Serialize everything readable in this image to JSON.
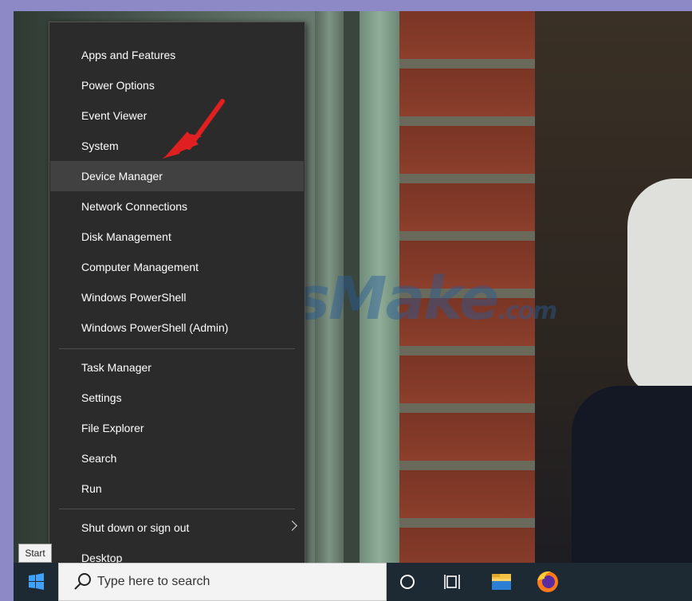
{
  "menu": {
    "items": [
      {
        "label": "Apps and Features"
      },
      {
        "label": "Power Options"
      },
      {
        "label": "Event Viewer"
      },
      {
        "label": "System"
      },
      {
        "label": "Device Manager",
        "highlighted": true
      },
      {
        "label": "Network Connections"
      },
      {
        "label": "Disk Management"
      },
      {
        "label": "Computer Management"
      },
      {
        "label": "Windows PowerShell"
      },
      {
        "label": "Windows PowerShell (Admin)"
      },
      {
        "label": "Task Manager"
      },
      {
        "label": "Settings"
      },
      {
        "label": "File Explorer"
      },
      {
        "label": "Search"
      },
      {
        "label": "Run"
      },
      {
        "label": "Shut down or sign out",
        "has_submenu": true
      },
      {
        "label": "Desktop"
      }
    ]
  },
  "tooltip": {
    "text": "Start"
  },
  "taskbar": {
    "search_placeholder": "Type here to search",
    "icons": [
      "windows-logo-icon",
      "search-icon",
      "cortana-circle-icon",
      "task-view-icon",
      "file-explorer-folder-icon",
      "firefox-icon"
    ]
  },
  "watermark": {
    "text": "TipsMake",
    "suffix": ".com"
  },
  "colors": {
    "menu_bg": "#2b2b2b",
    "menu_highlight": "#414141",
    "taskbar_bg": "#1e2a33",
    "accent_arrow": "#e02020"
  }
}
